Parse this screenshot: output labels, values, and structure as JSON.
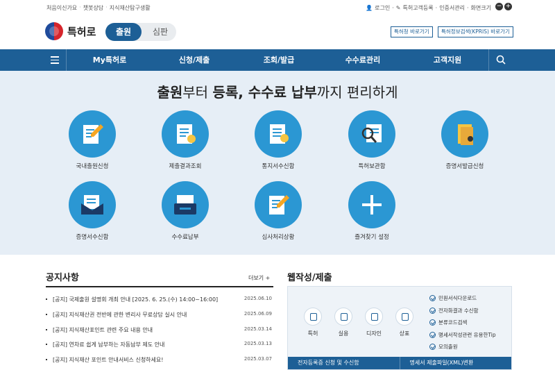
{
  "utility": {
    "left_links": [
      "처음이신가요",
      "챗봇상담",
      "지식재산탐구생활"
    ],
    "right_links": [
      "로그인",
      "특허고객등록",
      "인증서관리",
      "화면크기"
    ],
    "zoom_out": "−",
    "zoom_in": "+"
  },
  "header": {
    "logo_text": "특허로",
    "toggle_active": "출원",
    "toggle_inactive": "심판",
    "shortcut1": "특허청 바로가기",
    "shortcut2": "특허정보검색(KPRIS) 바로가기"
  },
  "nav": {
    "items": [
      "My특허로",
      "신청/제출",
      "조회/발급",
      "수수료관리",
      "고객지원"
    ]
  },
  "hero": {
    "title_bold1": "출원",
    "title_mid1": "부터 ",
    "title_bold2": "등록, 수수료 납부",
    "title_end": "까지 편리하게",
    "services": [
      {
        "label": "국내출원신청",
        "icon": "document-pen-icon"
      },
      {
        "label": "제출결과조회",
        "icon": "document-seal-icon"
      },
      {
        "label": "통지서수신함",
        "icon": "notice-seal-icon"
      },
      {
        "label": "특허보관함",
        "icon": "document-search-icon"
      },
      {
        "label": "증명서발급신청",
        "icon": "folder-icon"
      },
      {
        "label": "증명서수신함",
        "icon": "mail-icon"
      },
      {
        "label": "수수료납부",
        "icon": "payment-icon"
      },
      {
        "label": "심사처리상황",
        "icon": "clipboard-pen-icon"
      },
      {
        "label": "즐겨찾기 설정",
        "icon": "plus-icon"
      }
    ]
  },
  "notices": {
    "title": "공지사항",
    "more": "더보기 +",
    "items": [
      {
        "text": "[공지] 국제출원 설명회 개최 안내 [2025. 6. 25.(수) 14:00~16:00]",
        "date": "2025.06.10"
      },
      {
        "text": "[공지] 지식재산권 전반에 관한 변리사 무료상담 실시 안내",
        "date": "2025.06.09"
      },
      {
        "text": "[공지] 지식재산포인트 관련 주요 내용 안내",
        "date": "2025.03.14"
      },
      {
        "text": "[공지] 연차료 쉽게 납부하는 자동납부 제도 안내",
        "date": "2025.03.13"
      },
      {
        "text": "[공지] 지식재산 포인트 안내서비스 신청하세요!",
        "date": "2025.03.07"
      }
    ]
  },
  "web": {
    "title": "웹작성/제출",
    "items": [
      "특허",
      "실용",
      "디자인",
      "상표"
    ],
    "links": [
      "민원서식다운로드",
      "전자화결과 수신함",
      "분류코드검색",
      "명세서작성관련 유용한Tip",
      "모의출원"
    ],
    "bottom1": "전자등록증 신청 및 수신함",
    "bottom2": "명세서 제출파일(XML)변환"
  },
  "colors": {
    "brand_blue": "#1d5f96",
    "icon_blue": "#2b97d3",
    "hero_bg": "#e6eef6"
  }
}
